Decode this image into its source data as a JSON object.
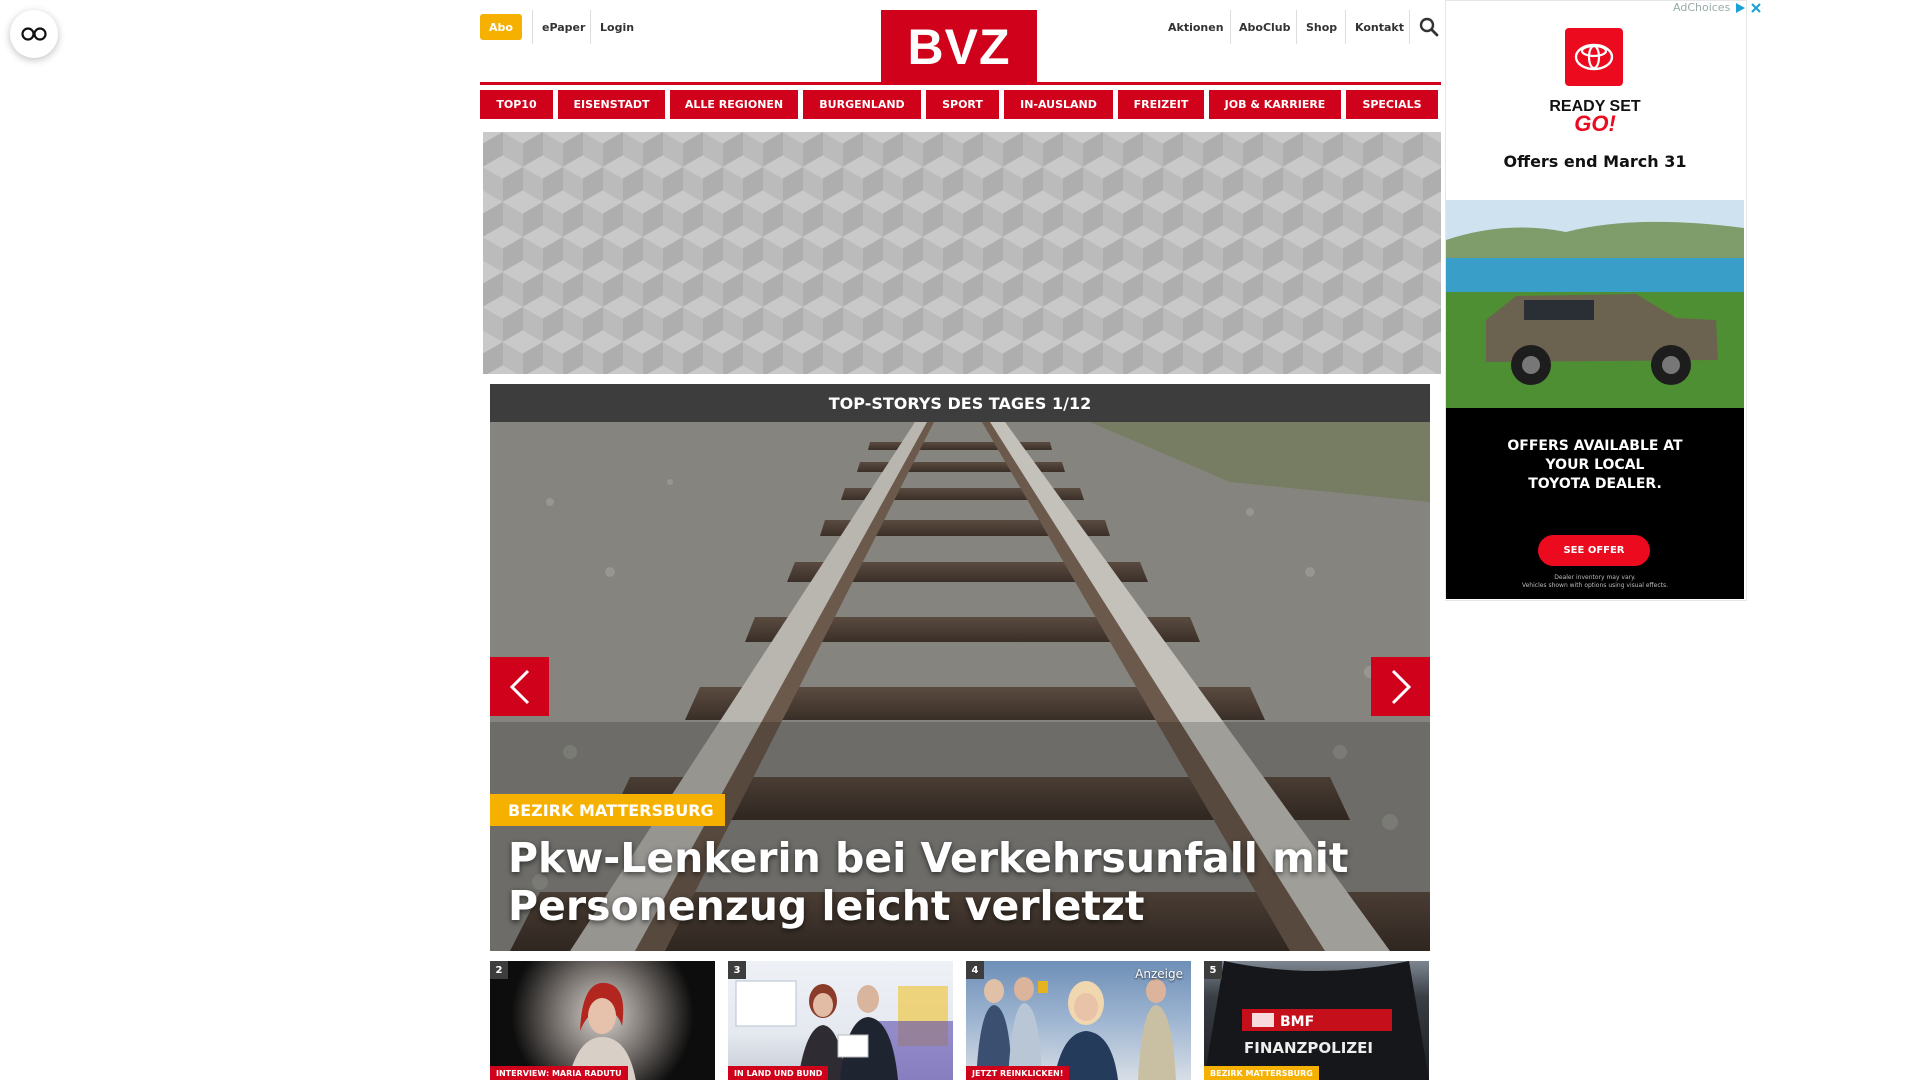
{
  "header": {
    "abo": "Abo",
    "epaper": "ePaper",
    "login": "Login",
    "logo": "BVZ",
    "right_links": [
      "Aktionen",
      "AboClub",
      "Shop",
      "Kontakt"
    ]
  },
  "nav": [
    "TOP10",
    "EISENSTADT",
    "ALLE REGIONEN",
    "BURGENLAND",
    "SPORT",
    "IN-AUSLAND",
    "FREIZEIT",
    "JOB & KARRIERE",
    "SPECIALS"
  ],
  "topstories": {
    "heading": "TOP-STORYS DES TAGES 1/12",
    "hero": {
      "category": "BEZIRK MATTERSBURG",
      "title": "Pkw-Lenkerin bei Verkehrsunfall mit Personenzug leicht verletzt"
    },
    "thumbs": [
      {
        "num": "2",
        "category": "INTERVIEW: MARIA RADUTU",
        "badge": ""
      },
      {
        "num": "3",
        "category": "IN LAND UND BUND",
        "badge": ""
      },
      {
        "num": "4",
        "category": "JETZT REINKLICKEN!",
        "badge": "Anzeige"
      },
      {
        "num": "5",
        "category": "BEZIRK MATTERSBURG",
        "badge": ""
      }
    ]
  },
  "ad": {
    "choices": "AdChoices",
    "ready": "READY SET",
    "go": "GO!",
    "offer": "Offers end March 31",
    "body": [
      "OFFERS AVAILABLE AT",
      "YOUR LOCAL",
      "TOYOTA DEALER."
    ],
    "cta": "SEE OFFER",
    "fine": [
      "Dealer inventory may vary.",
      "Vehicles shown with options using visual effects."
    ]
  },
  "colors": {
    "brand_red": "#d0021b",
    "accent_yellow": "#f6b100",
    "toyota_red": "#eb0a1e",
    "dark_gray": "#3d3d3d"
  },
  "icons": [
    "accessibility-icon",
    "search-icon",
    "chevron-left-icon",
    "chevron-right-icon",
    "toyota-logo-icon",
    "adchoices-icon",
    "close-icon"
  ]
}
